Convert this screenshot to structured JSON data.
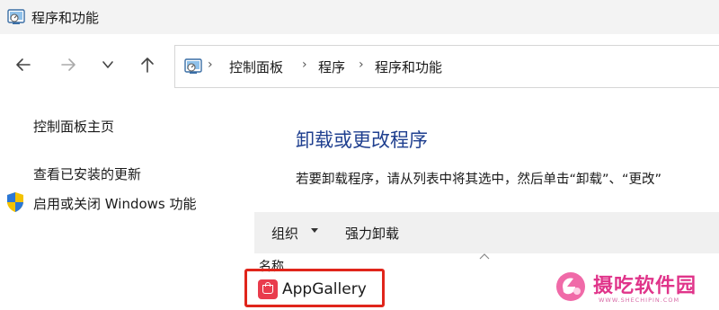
{
  "window": {
    "title": "程序和功能",
    "icon": "control-panel-icon"
  },
  "navigation": {
    "back_icon": "arrow-left-icon",
    "forward_icon": "arrow-right-icon",
    "recent_icon": "chevron-down-icon",
    "up_icon": "arrow-up-icon"
  },
  "address_bar": {
    "icon": "control-panel-icon",
    "breadcrumbs": [
      "控制面板",
      "程序",
      "程序和功能"
    ],
    "separator": "›"
  },
  "sidebar": {
    "items": [
      {
        "label": "控制面板主页"
      },
      {
        "label": "查看已安装的更新"
      },
      {
        "label": "启用或关闭 Windows 功能",
        "icon": "shield-icon"
      }
    ]
  },
  "main": {
    "heading": "卸载或更改程序",
    "description": "若要卸载程序，请从列表中将其选中，然后单击“卸载”、“更改”"
  },
  "command_bar": {
    "organize": "组织",
    "force_uninstall": "强力卸载"
  },
  "list": {
    "column_name": "名称",
    "items": [
      {
        "name": "AppGallery",
        "icon": "appgallery-icon",
        "highlighted": true
      }
    ]
  },
  "colors": {
    "heading": "#1f3f8f",
    "highlight": "#e0251b",
    "watermark": "#e0348a",
    "appgallery": "#e93c4d"
  },
  "watermark": {
    "text": "摄吃软件园",
    "subtext": "WWW.SHECHIPIN.COM"
  }
}
